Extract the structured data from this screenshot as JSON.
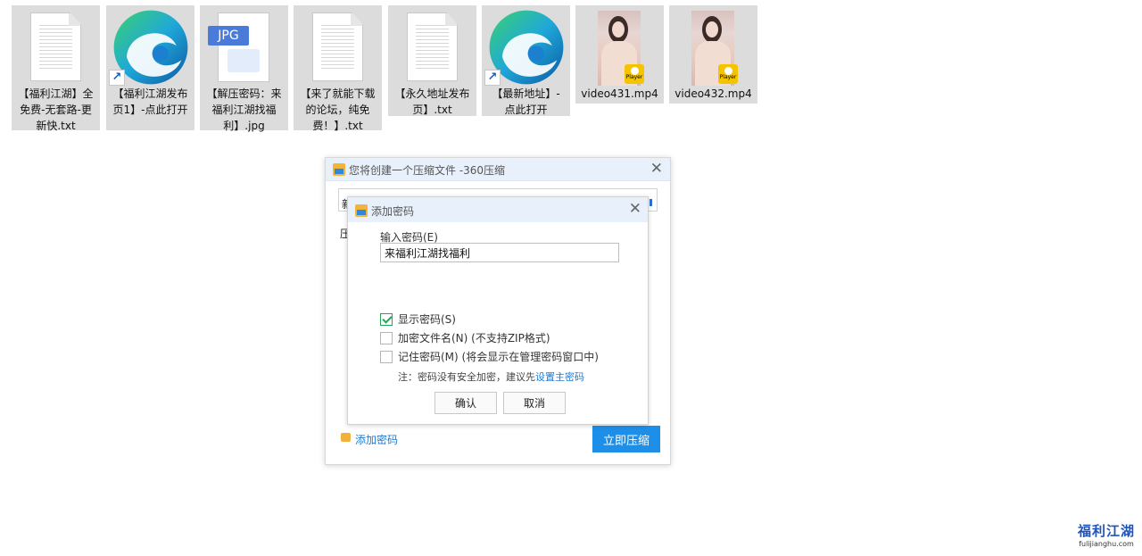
{
  "desktop_files": [
    {
      "name": "【福利江湖】全免费-无套路-更新快.txt",
      "type": "txt"
    },
    {
      "name": "【福利江湖发布页1】-点此打开",
      "type": "edge-shortcut"
    },
    {
      "name": "【解压密码：来福利江湖找福利】.jpg",
      "type": "jpg",
      "badge": "JPG"
    },
    {
      "name": "【来了就能下载的论坛，纯免费！】.txt",
      "type": "txt"
    },
    {
      "name": "【永久地址发布页】.txt",
      "type": "txt"
    },
    {
      "name": "【最新地址】-点此打开",
      "type": "edge-shortcut"
    },
    {
      "name": "video431.mp4",
      "type": "video"
    },
    {
      "name": "video432.mp4",
      "type": "video"
    }
  ],
  "main_dialog": {
    "title": "您将创建一个压缩文件 -360压缩",
    "bg_char_1": "新",
    "bg_char_2": "压",
    "add_password_link": "添加密码",
    "compress_button": "立即压缩"
  },
  "password_dialog": {
    "title": "添加密码",
    "input_label": "输入密码(E)",
    "password_value": "来福利江湖找福利",
    "options": [
      {
        "label": "显示密码(S)",
        "checked": true
      },
      {
        "label": "加密文件名(N) (不支持ZIP格式)",
        "checked": false
      },
      {
        "label": "记住密码(M) (将会显示在管理密码窗口中)",
        "checked": false
      }
    ],
    "note_prefix": "注：密码没有安全加密，建议先",
    "note_link": "设置主密码",
    "ok_button": "确认",
    "cancel_button": "取消"
  },
  "watermark": {
    "title": "福利江湖",
    "url": "fulijianghu.com"
  },
  "colors": {
    "accent": "#1e8fe9",
    "titlebar": "#e8f1fb",
    "check": "#27a35a",
    "link": "#1f7ad3"
  }
}
